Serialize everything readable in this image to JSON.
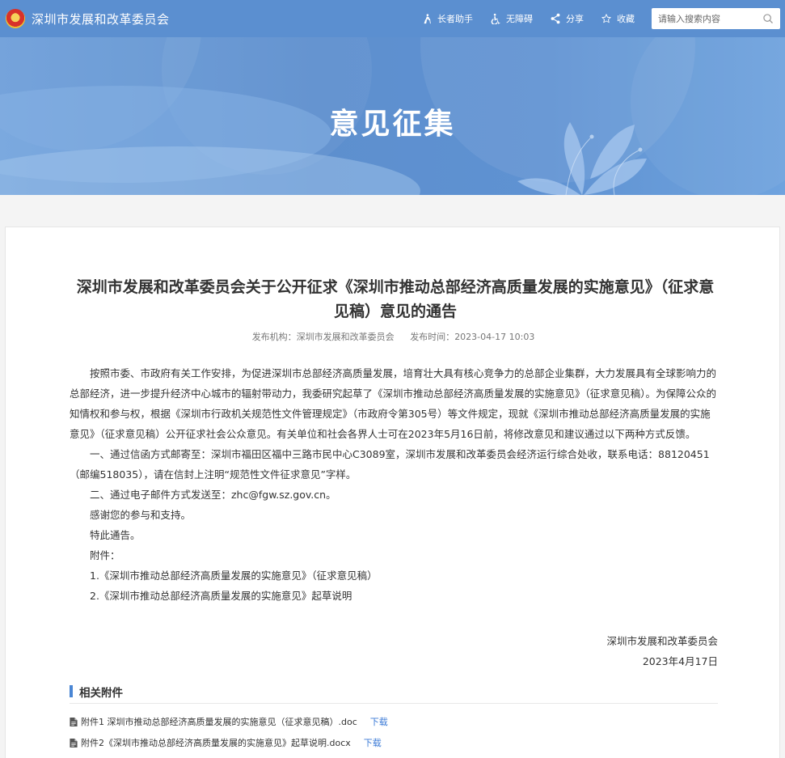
{
  "header": {
    "site_name": "深圳市发展和改革委员会",
    "tools": [
      {
        "label": "长者助手",
        "icon": "elder-assistant-icon"
      },
      {
        "label": "无障碍",
        "icon": "accessibility-icon"
      },
      {
        "label": "分享",
        "icon": "share-icon"
      },
      {
        "label": "收藏",
        "icon": "star-icon"
      }
    ],
    "search_placeholder": "请输入搜索内容"
  },
  "banner": {
    "title": "意见征集"
  },
  "article": {
    "title": "深圳市发展和改革委员会关于公开征求《深圳市推动总部经济高质量发展的实施意见》（征求意见稿）意见的通告",
    "publisher_label": "发布机构：",
    "publisher": "深圳市发展和改革委员会",
    "date_label": "发布时间：",
    "date": "2023-04-17 10:03",
    "paragraphs": [
      "按照市委、市政府有关工作安排，为促进深圳市总部经济高质量发展，培育壮大具有核心竞争力的总部企业集群，大力发展具有全球影响力的总部经济，进一步提升经济中心城市的辐射带动力，我委研究起草了《深圳市推动总部经济高质量发展的实施意见》（征求意见稿）。为保障公众的知情权和参与权，根据《深圳市行政机关规范性文件管理规定》（市政府令第305号）等文件规定，现就《深圳市推动总部经济高质量发展的实施意见》（征求意见稿）公开征求社会公众意见。有关单位和社会各界人士可在2023年5月16日前，将修改意见和建议通过以下两种方式反馈。",
      "一、通过信函方式邮寄至：深圳市福田区福中三路市民中心C3089室，深圳市发展和改革委员会经济运行综合处收，联系电话：88120451（邮编518035），请在信封上注明“规范性文件征求意见”字样。",
      "二、通过电子邮件方式发送至：zhc@fgw.sz.gov.cn。",
      "感谢您的参与和支持。",
      "特此通告。",
      "附件：",
      "1.《深圳市推动总部经济高质量发展的实施意见》（征求意见稿）",
      "2.《深圳市推动总部经济高质量发展的实施意见》起草说明"
    ],
    "signature_org": "深圳市发展和改革委员会",
    "signature_date": "2023年4月17日"
  },
  "attachments": {
    "heading": "相关附件",
    "download_label": "下载",
    "files": [
      {
        "name": "附件1 深圳市推动总部经济高质量发展的实施意见（征求意见稿）.doc"
      },
      {
        "name": "附件2《深圳市推动总部经济高质量发展的实施意见》起草说明.docx"
      }
    ]
  },
  "colors": {
    "nav_bg": "#5b8fd0",
    "accent": "#4a86d4",
    "link": "#3b7ad6"
  }
}
